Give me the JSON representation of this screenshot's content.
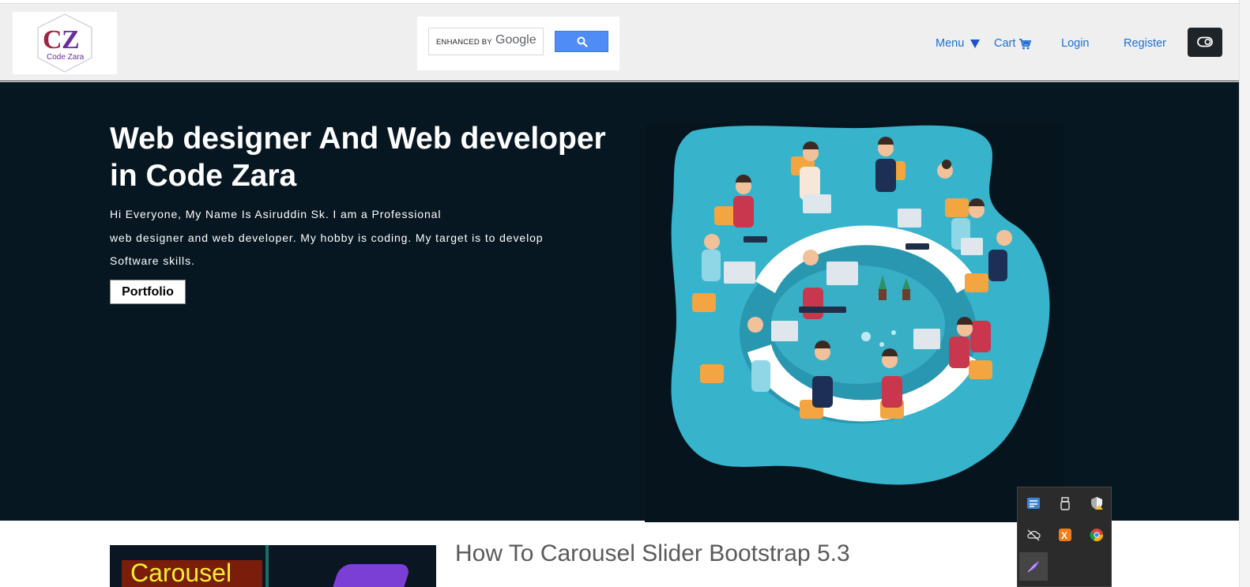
{
  "header": {
    "logo": {
      "monogram": "CZ",
      "name": "Code Zara",
      "icon": "code-zara-logo"
    },
    "search": {
      "enhanced_by": "ENHANCED BY",
      "google": "Google",
      "button_icon": "search-icon"
    },
    "nav": {
      "menu": "Menu",
      "cart": "Cart",
      "login": "Login",
      "register": "Register",
      "menu_icon": "triangle-down-icon",
      "cart_icon": "cart-icon",
      "toggle_icon": "theme-toggle-icon"
    }
  },
  "hero": {
    "title": "Web designer And Web developer in Code Zara",
    "line1": "Hi Everyone, My Name Is Asiruddin Sk. I am a Professional",
    "line2": "web designer and web developer. My hobby is coding. My target is to develop",
    "line3": "Software skills.",
    "button": "Portfolio",
    "illustration": "team-meeting-illustration"
  },
  "post": {
    "thumbnail_label": "Carousel",
    "title": "How To Carousel Slider Bootstrap 5.3"
  },
  "tray": {
    "icons": [
      "network-app-icon",
      "usb-drive-icon",
      "security-shield-icon",
      "cloud-offline-icon",
      "xampp-icon",
      "chrome-icon",
      "feather-pen-icon"
    ]
  },
  "colors": {
    "hero_bg": "#071722",
    "link": "#1a6fd6",
    "header_bg": "#efefef",
    "blob": "#37b3cc"
  }
}
